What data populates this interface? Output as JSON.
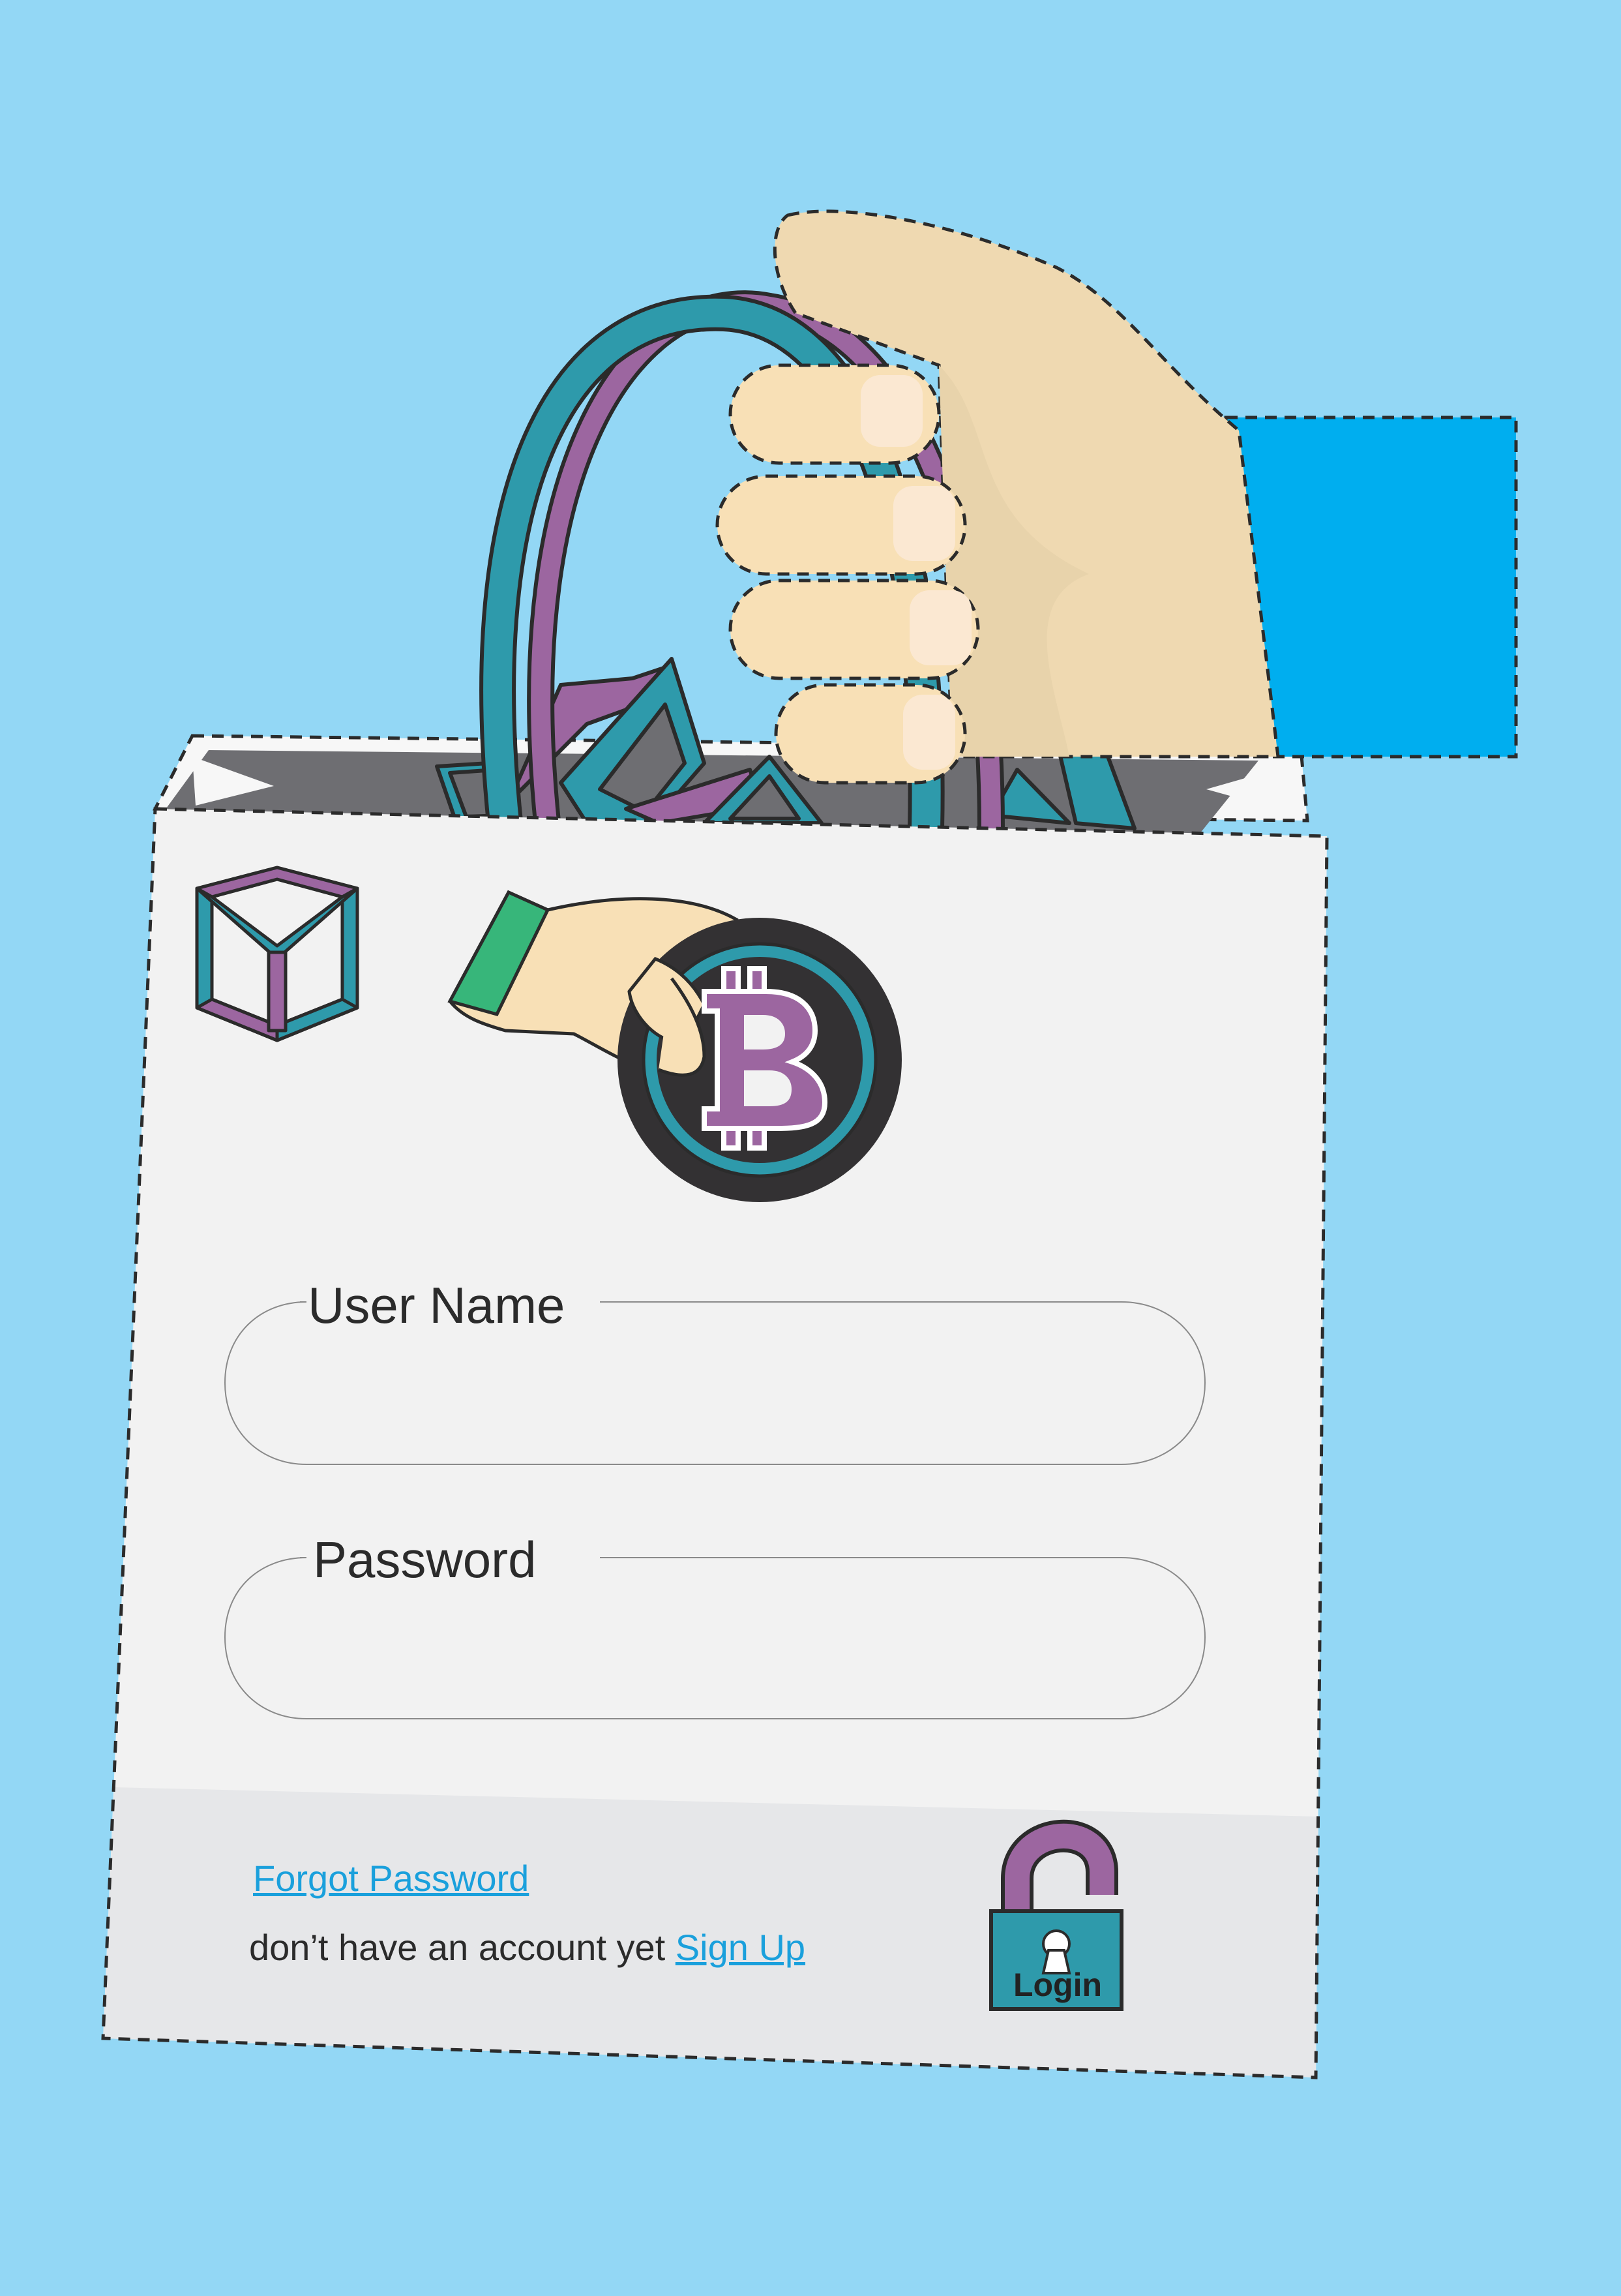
{
  "form": {
    "username_label": "User Name",
    "username_value": "",
    "password_label": "Password",
    "password_value": ""
  },
  "footer": {
    "forgot_password": "Forgot Password",
    "no_account_text": "don’t have an account yet ",
    "sign_up": "Sign Up"
  },
  "login_button": {
    "label": "Login"
  },
  "colors": {
    "background": "#93d7f5",
    "bag": "#f2f2f2",
    "bag_footer": "#e6e7e9",
    "teal": "#2e9aab",
    "purple": "#9c66a0",
    "skin": "#f8e0b6",
    "sleeve": "#00aeef",
    "link": "#1aa0dc"
  },
  "icons": [
    "logo-cube-icon",
    "bitcoin-coin-icon",
    "padlock-open-icon"
  ]
}
